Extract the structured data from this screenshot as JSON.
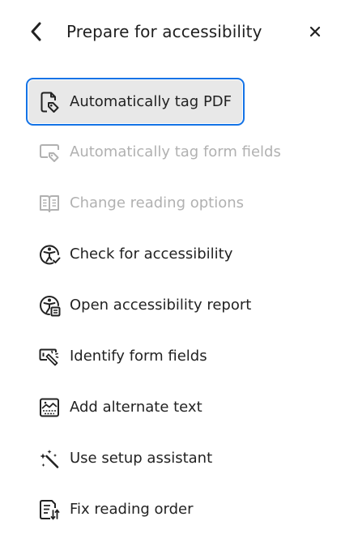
{
  "panel": {
    "title": "Prepare for accessibility",
    "back_icon": "chevron-left-icon",
    "close_icon": "close-icon"
  },
  "tools": [
    {
      "label": "Automatically tag PDF",
      "icon": "tag-pdf-icon",
      "state": "selected"
    },
    {
      "label": "Automatically tag form fields",
      "icon": "tag-form-fields-icon",
      "state": "disabled"
    },
    {
      "label": "Change reading options",
      "icon": "book-icon",
      "state": "disabled"
    },
    {
      "label": "Check for accessibility",
      "icon": "accessibility-check-icon",
      "state": "enabled"
    },
    {
      "label": "Open accessibility report",
      "icon": "accessibility-report-icon",
      "state": "enabled"
    },
    {
      "label": "Identify form fields",
      "icon": "identify-fields-icon",
      "state": "enabled"
    },
    {
      "label": "Add alternate text",
      "icon": "image-alt-text-icon",
      "state": "enabled"
    },
    {
      "label": "Use setup assistant",
      "icon": "magic-wand-icon",
      "state": "enabled"
    },
    {
      "label": "Fix reading order",
      "icon": "reading-order-icon",
      "state": "enabled"
    }
  ],
  "colors": {
    "accent": "#1473e6",
    "selected_bg": "#e8e8e8",
    "text": "#222222",
    "disabled_text": "#b1b1b1"
  }
}
